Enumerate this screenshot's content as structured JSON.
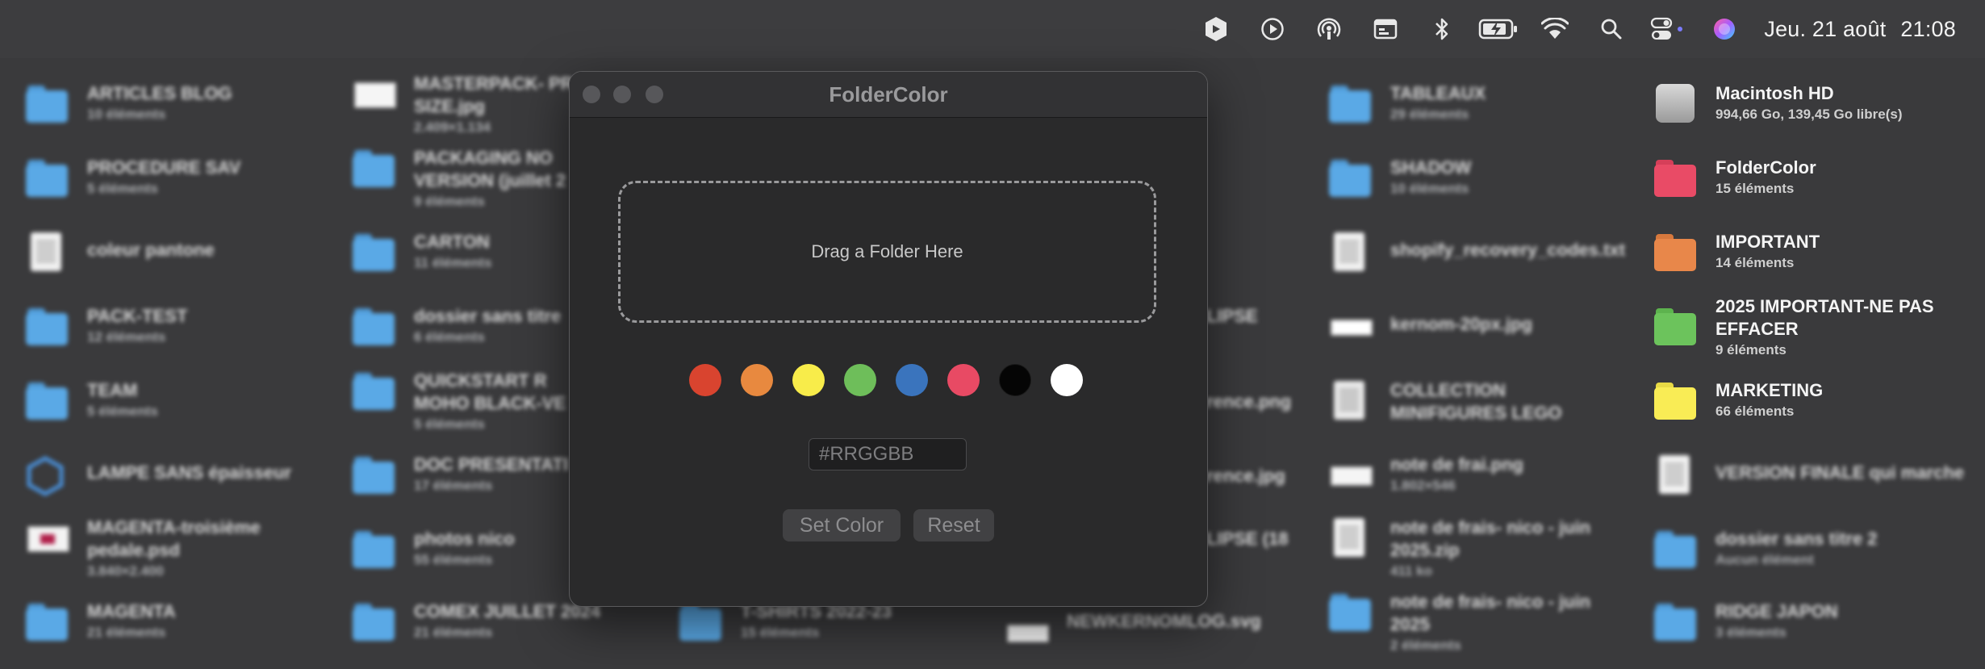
{
  "menubar": {
    "icons": [
      "app-extension-icon",
      "play-circle-icon",
      "airplay-broadcast-icon",
      "screen-mirror-icon",
      "bluetooth-icon",
      "battery-charging-icon",
      "wifi-icon",
      "spotlight-search-icon",
      "control-center-icon",
      "siri-icon"
    ],
    "date": "Jeu. 21 août",
    "time": "21:08"
  },
  "desktop": {
    "col1": [
      {
        "name": "ARTICLES BLOG",
        "sub": "10 éléments",
        "icon": "folder-icon"
      },
      {
        "name": "PROCEDURE SAV",
        "sub": "5 éléments",
        "icon": "folder-icon"
      },
      {
        "name": "coleur pantone",
        "sub": "",
        "icon": "document-icon"
      },
      {
        "name": "PACK-TEST",
        "sub": "12 éléments",
        "icon": "folder-icon"
      },
      {
        "name": "TEAM",
        "sub": "5 éléments",
        "icon": "folder-icon"
      },
      {
        "name": "LAMPE SANS épaisseur",
        "sub": "",
        "icon": "sketchup-file-icon"
      },
      {
        "name": "MAGENTA-troisième pedale.psd",
        "sub": "3.840×2.400",
        "icon": "image-file-icon"
      },
      {
        "name": "MAGENTA",
        "sub": "21 éléments",
        "icon": "folder-icon"
      }
    ],
    "col2": [
      {
        "name": "MASTERPACK- PR SIZE.jpg",
        "sub": "2.409×1.134",
        "icon": "image-file-icon"
      },
      {
        "name": "PACKAGING NO VERSION (juillet 2",
        "sub": "9 éléments",
        "icon": "folder-icon"
      },
      {
        "name": "CARTON",
        "sub": "11 éléments",
        "icon": "folder-icon"
      },
      {
        "name": "dossier sans titre",
        "sub": "6 éléments",
        "icon": "folder-icon"
      },
      {
        "name": "QUICKSTART R MOHO BLACK-VE",
        "sub": "5 éléments",
        "icon": "folder-icon"
      },
      {
        "name": "DOC PRESENTATI",
        "sub": "17 éléments",
        "icon": "folder-icon"
      },
      {
        "name": "photos nico",
        "sub": "55 éléments",
        "icon": "folder-icon"
      },
      {
        "name": "COMEX JUILLET 2024",
        "sub": "21 éléments",
        "icon": "folder-icon"
      }
    ],
    "col3": [
      {
        "name": "T-SHIRTS 2022-23",
        "sub": "15 éléments",
        "icon": "folder-icon"
      }
    ],
    "col4": [
      {
        "name": "LIPSE",
        "sub": ""
      },
      {
        "name": "rence.png",
        "sub": ""
      },
      {
        "name": "rence.jpg",
        "sub": ""
      },
      {
        "name": "LIPSE (18",
        "sub": ""
      },
      {
        "name": "NEWKERNOMLOG.svg",
        "sub": "",
        "icon": "image-file-icon"
      }
    ],
    "col5": [
      {
        "name": "TABLEAUX",
        "sub": "29 éléments",
        "icon": "folder-icon"
      },
      {
        "name": "SHADOW",
        "sub": "10 éléments",
        "icon": "folder-icon"
      },
      {
        "name": "shopify_recovery_codes.txt",
        "sub": "",
        "icon": "document-icon"
      },
      {
        "name": "kernom-20px.jpg",
        "sub": "",
        "icon": "image-file-icon"
      },
      {
        "name": "COLLECTION MINIFIGURES LEGO",
        "sub": "",
        "icon": "document-icon"
      },
      {
        "name": "note de frai.png",
        "sub": "1.802×546",
        "icon": "image-file-icon"
      },
      {
        "name": "note de frais- nico - juin 2025.zip",
        "sub": "411 ko",
        "icon": "zip-file-icon"
      },
      {
        "name": "note de frais- nico - juin 2025",
        "sub": "2 éléments",
        "icon": "folder-icon"
      }
    ],
    "col6": [
      {
        "name": "Macintosh HD",
        "sub": "994,66 Go, 139,45 Go libre(s)",
        "icon": "hard-drive-icon"
      },
      {
        "name": "FolderColor",
        "sub": "15 éléments",
        "icon": "folder-icon"
      },
      {
        "name": "IMPORTANT",
        "sub": "14 éléments",
        "icon": "folder-icon"
      },
      {
        "name": "2025 IMPORTANT-NE PAS EFFACER",
        "sub": "9 éléments",
        "icon": "folder-icon"
      },
      {
        "name": "MARKETING",
        "sub": "66 éléments",
        "icon": "folder-icon"
      },
      {
        "name": "VERSION FINALE qui marche",
        "sub": "",
        "icon": "document-icon"
      },
      {
        "name": "dossier sans titre 2",
        "sub": "Aucun élément",
        "icon": "folder-icon"
      },
      {
        "name": "RIDGE JAPON",
        "sub": "3 éléments",
        "icon": "folder-icon"
      }
    ]
  },
  "colors": {
    "folder_blue": "#5aa9e6",
    "folder_red": "#e94b66",
    "folder_orange": "#e8874a",
    "folder_green": "#6cc35c",
    "folder_yellow": "#f9ec55"
  },
  "window": {
    "title": "FolderColor",
    "dropzone_text": "Drag a Folder Here",
    "swatches": [
      {
        "name": "red",
        "color": "#d9442f"
      },
      {
        "name": "orange",
        "color": "#e8893f"
      },
      {
        "name": "yellow",
        "color": "#f8ec4a"
      },
      {
        "name": "green",
        "color": "#6ebe5a"
      },
      {
        "name": "blue",
        "color": "#3a74bd"
      },
      {
        "name": "pink",
        "color": "#e84a64"
      },
      {
        "name": "black",
        "color": "#050505"
      },
      {
        "name": "white",
        "color": "#ffffff"
      }
    ],
    "hex_placeholder": "#RRGGBB",
    "set_color_label": "Set Color",
    "reset_label": "Reset"
  }
}
